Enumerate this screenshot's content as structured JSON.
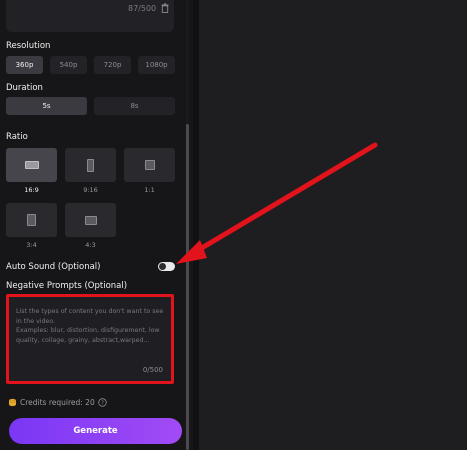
{
  "prompt": {
    "count": "87/500"
  },
  "resolution": {
    "label": "Resolution",
    "options": [
      "360p",
      "540p",
      "720p",
      "1080p"
    ],
    "selected": "360p"
  },
  "duration": {
    "label": "Duration",
    "options": [
      "5s",
      "8s"
    ],
    "selected": "5s"
  },
  "ratio": {
    "label": "Ratio",
    "options": [
      "16:9",
      "9:16",
      "1:1",
      "3:4",
      "4:3"
    ],
    "selected": "16:9"
  },
  "auto_sound": {
    "label": "Auto Sound (Optional)",
    "enabled": false
  },
  "negative_prompts": {
    "label": "Negative Prompts (Optional)",
    "placeholder": "List the types of content you don't want to see in the video.\nExamples: blur, distortion, disfigurement, low quality, collage, grainy,  abstract,warped...",
    "count": "0/500"
  },
  "credits": {
    "text": "Credits required: 20"
  },
  "generate": {
    "label": "Generate"
  },
  "colors": {
    "accent": "#8b3ff6",
    "annotation": "#e3131b"
  }
}
